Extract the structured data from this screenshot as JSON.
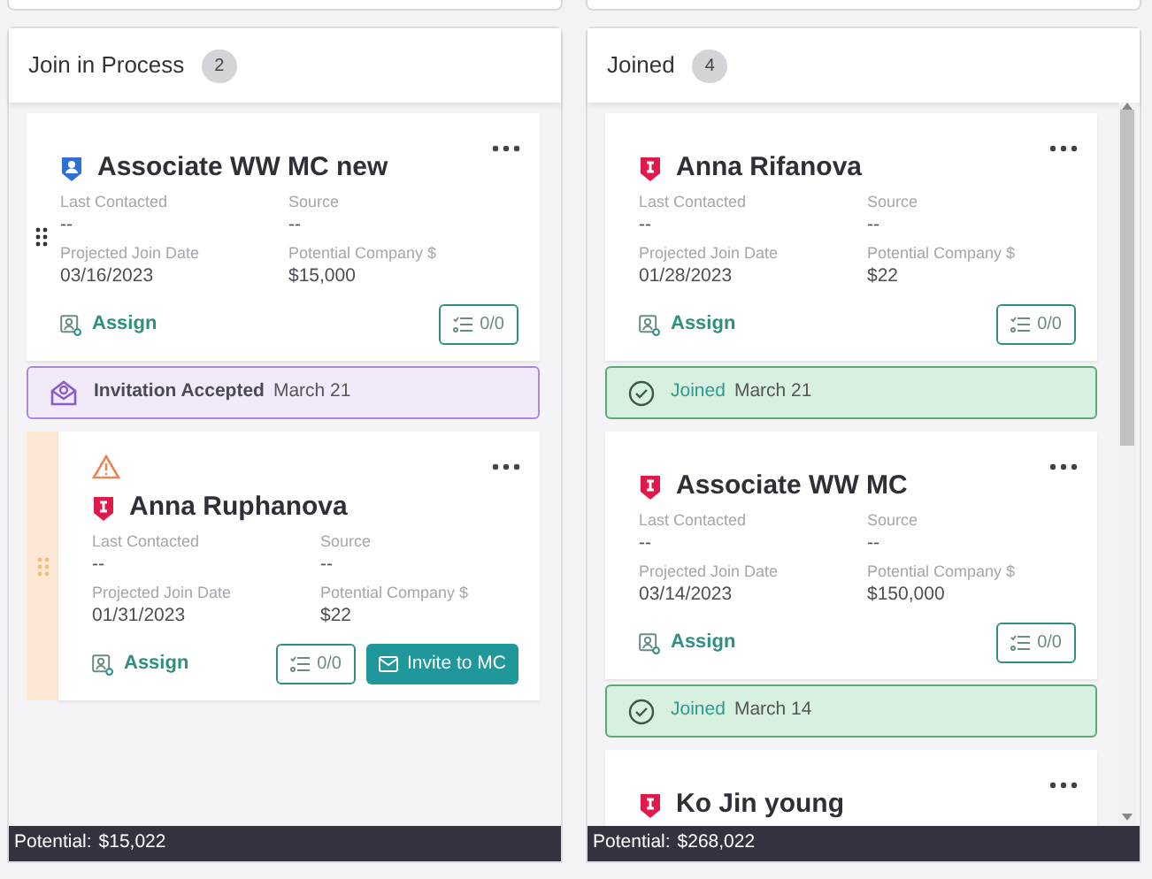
{
  "columns": [
    {
      "title": "Join in Process",
      "count": "2",
      "scrollable": false,
      "footer": {
        "label": "Potential:",
        "value": "$15,022"
      },
      "cards": [
        {
          "kind": "associate",
          "warning": false,
          "hovered": true,
          "dragging": false,
          "name": "Associate WW MC new",
          "fields": [
            {
              "label": "Last Contacted",
              "value": "--"
            },
            {
              "label": "Source",
              "value": "--"
            },
            {
              "label": "Projected Join Date",
              "value": "03/16/2023"
            },
            {
              "label": "Potential Company $",
              "value": "$15,000"
            }
          ],
          "assign": "Assign",
          "tasks": "0/0",
          "status": {
            "kind": "invitation",
            "label": "Invitation Accepted",
            "date": "March 21"
          }
        },
        {
          "kind": "individual",
          "warning": true,
          "hovered": false,
          "dragging": true,
          "name": "Anna Ruphanova",
          "fields": [
            {
              "label": "Last Contacted",
              "value": "--"
            },
            {
              "label": "Source",
              "value": "--"
            },
            {
              "label": "Projected Join Date",
              "value": "01/31/2023"
            },
            {
              "label": "Potential Company $",
              "value": "$22"
            }
          ],
          "assign": "Assign",
          "tasks": "0/0",
          "invite": "Invite to MC"
        }
      ]
    },
    {
      "title": "Joined",
      "count": "4",
      "scrollable": true,
      "footer": {
        "label": "Potential:",
        "value": "$268,022"
      },
      "cards": [
        {
          "kind": "individual",
          "warning": false,
          "hovered": false,
          "dragging": false,
          "name": "Anna Rifanova",
          "fields": [
            {
              "label": "Last Contacted",
              "value": "--"
            },
            {
              "label": "Source",
              "value": "--"
            },
            {
              "label": "Projected Join Date",
              "value": "01/28/2023"
            },
            {
              "label": "Potential Company $",
              "value": "$22"
            }
          ],
          "assign": "Assign",
          "tasks": "0/0",
          "status": {
            "kind": "joined",
            "label": "Joined",
            "date": "March 21"
          }
        },
        {
          "kind": "individual",
          "warning": false,
          "hovered": false,
          "dragging": false,
          "name": "Associate WW MC",
          "fields": [
            {
              "label": "Last Contacted",
              "value": "--"
            },
            {
              "label": "Source",
              "value": "--"
            },
            {
              "label": "Projected Join Date",
              "value": "03/14/2023"
            },
            {
              "label": "Potential Company $",
              "value": "$150,000"
            }
          ],
          "assign": "Assign",
          "tasks": "0/0",
          "status": {
            "kind": "joined",
            "label": "Joined",
            "date": "March 14"
          }
        },
        {
          "kind": "individual",
          "warning": false,
          "hovered": false,
          "dragging": false,
          "name": "Ko Jin young"
        }
      ]
    }
  ]
}
